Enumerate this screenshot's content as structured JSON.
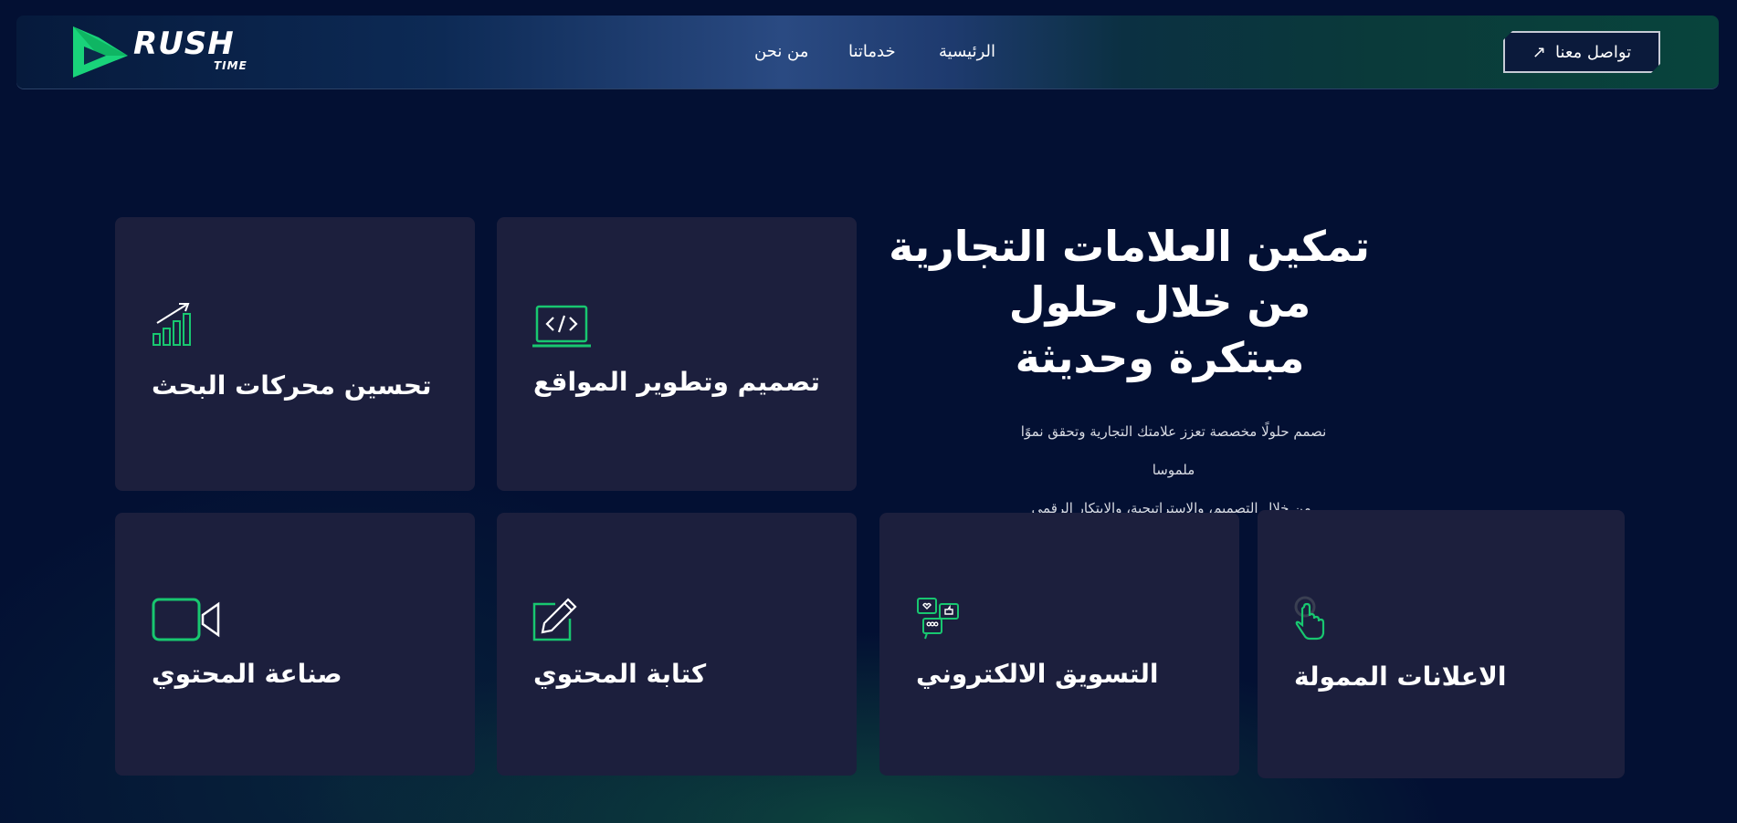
{
  "header": {
    "logo": {
      "word": "RUSH",
      "sub": "TIME"
    },
    "nav": [
      "الرئيسية",
      "خدماتنا",
      "من نحن"
    ],
    "contact_label": "تواصل معنا",
    "contact_icon": "arrow-up-right-icon"
  },
  "hero": {
    "title_lines": [
      "تمكين العلامات التجارية",
      "من خلال حلول",
      "مبتكرة وحديثة"
    ],
    "sub_lines": [
      "نصمم حلولًا مخصصة تعزز علامتك التجارية وتحقق نموًا ملموسا",
      ".من خلال التصميم، والاستراتيجية، والابتكار الرقمي"
    ]
  },
  "services": [
    {
      "label": "تحسين محركات البحث",
      "icon": "growth-chart-icon"
    },
    {
      "label": "تصميم وتطوير المواقع",
      "icon": "code-laptop-icon"
    },
    {
      "label": "صناعة المحتوي",
      "icon": "video-camera-icon"
    },
    {
      "label": "كتابة المحتوي",
      "icon": "pencil-edit-icon"
    },
    {
      "label": "التسويق الالكتروني",
      "icon": "social-chat-icon"
    },
    {
      "label": "الاعلانات الممولة",
      "icon": "tap-hand-icon"
    }
  ],
  "colors": {
    "accent": "#18c770",
    "background": "#031033",
    "card": "#1c1f3d"
  }
}
